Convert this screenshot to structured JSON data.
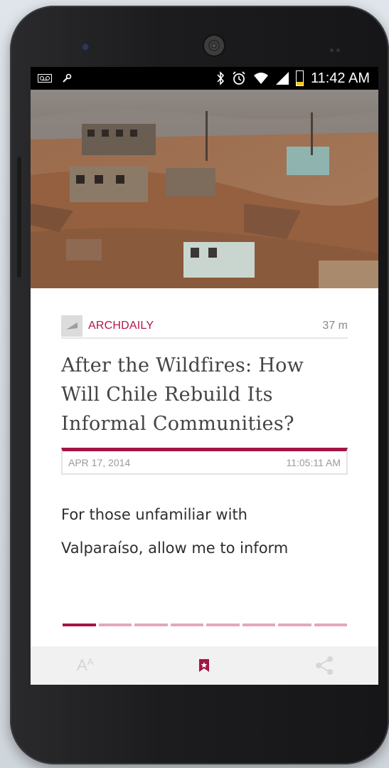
{
  "status_bar": {
    "time": "11:42 AM"
  },
  "article": {
    "source": "ARCHDAILY",
    "age": "37 m",
    "headline": "After the Wildfires: How Will Chile Rebuild Its Informal Communities?",
    "date": "APR 17, 2014",
    "time": "11:05:11 AM",
    "excerpt_line1": "For those unfamiliar with",
    "excerpt_line2": "Valparaíso, allow me to inform"
  },
  "pager": {
    "total_pages": 8,
    "current_page": 1
  },
  "bottom_bar": {
    "font_size_label": "A",
    "font_size_small": "A"
  },
  "colors": {
    "accent": "#a31546",
    "accent_light": "#e2a9bb"
  }
}
